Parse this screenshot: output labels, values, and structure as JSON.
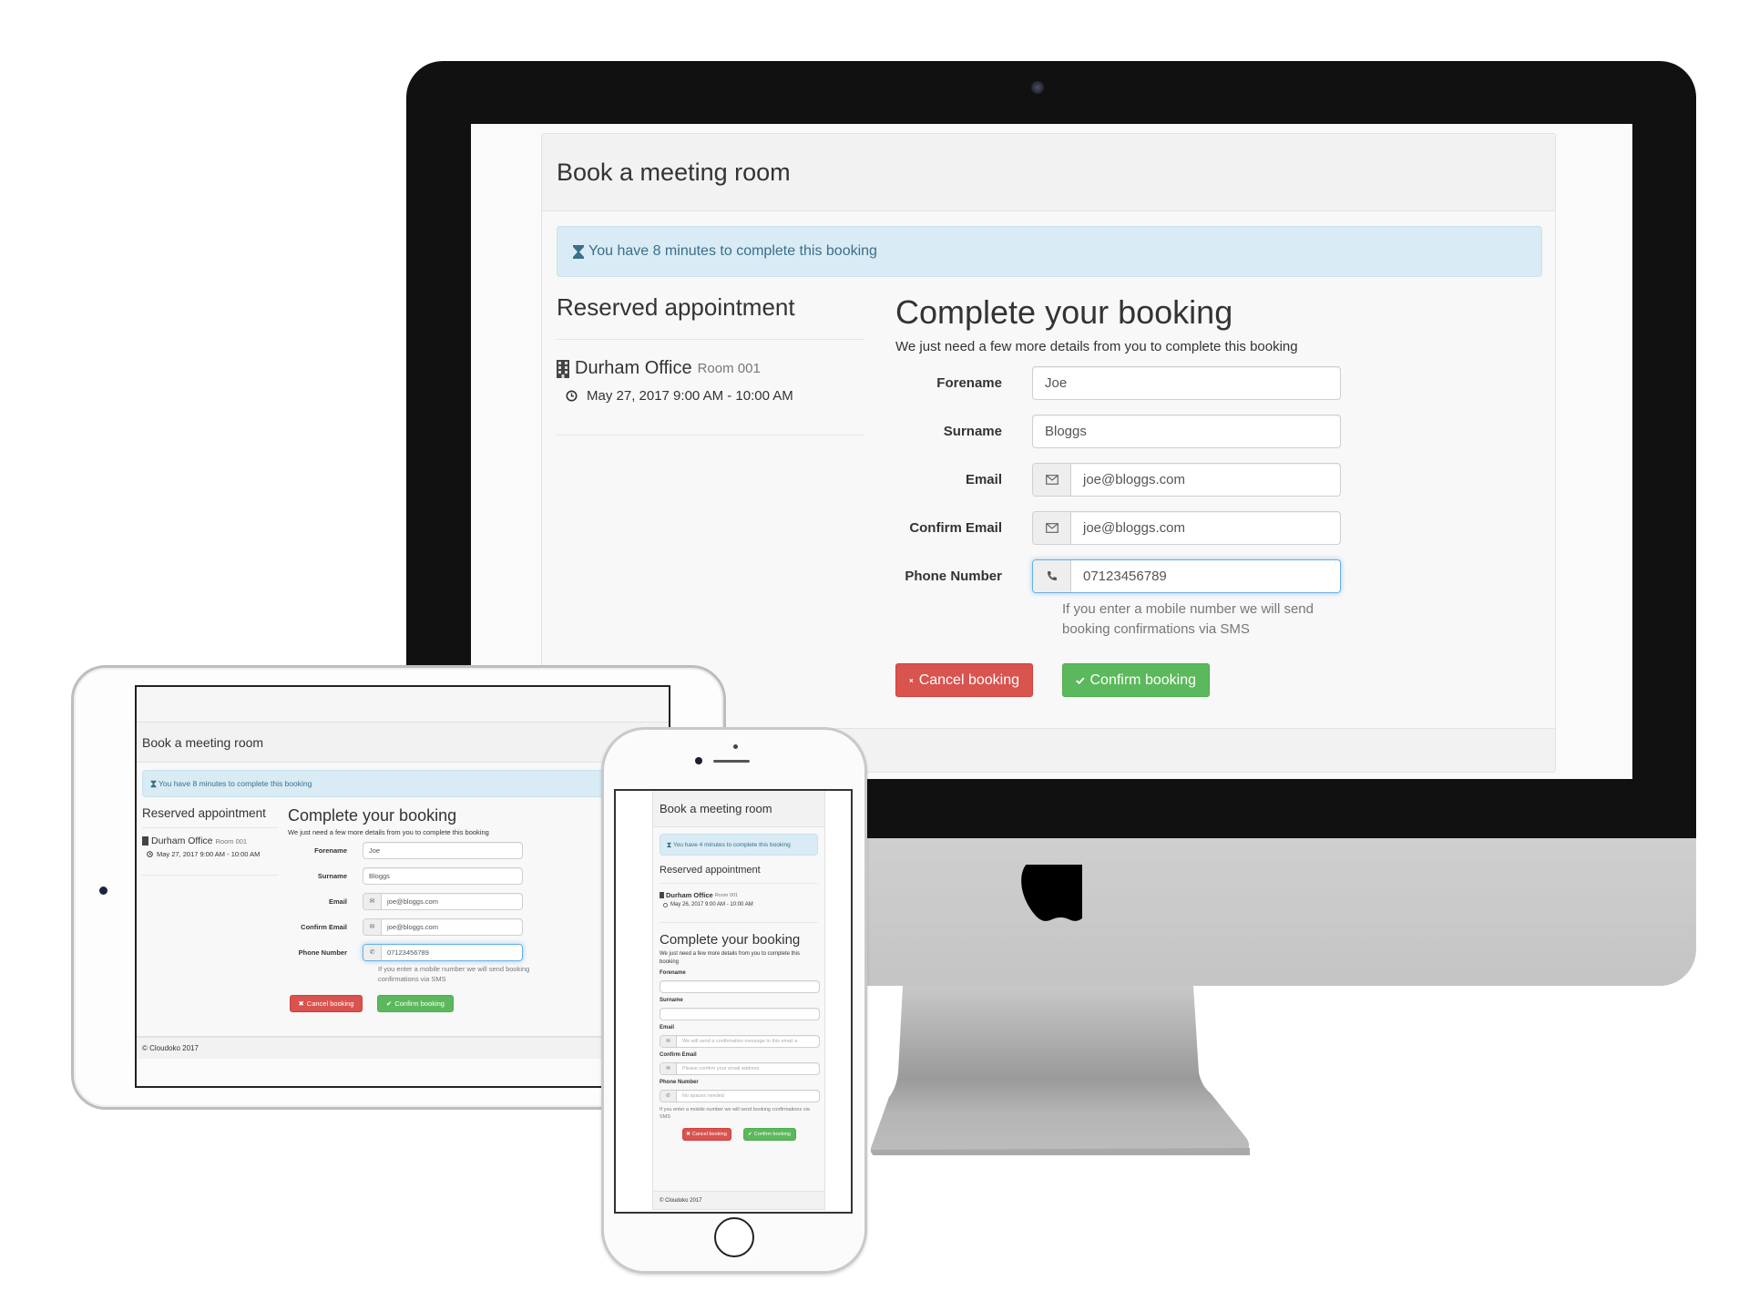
{
  "colors": {
    "danger": "#d9534f",
    "success": "#5cb85c",
    "info_bg": "#d9ebf4",
    "info_text": "#3a6f8c",
    "focus": "#66afe9"
  },
  "desktop": {
    "panel_title": "Book a meeting room",
    "alert": {
      "icon": "hourglass-icon",
      "text": "You have 8 minutes to complete this booking"
    },
    "reserved": {
      "heading": "Reserved appointment",
      "office_icon": "building-icon",
      "office": "Durham Office",
      "room": "Room 001",
      "time_icon": "clock-icon",
      "datetime": "May 27, 2017 9:00 AM - 10:00 AM"
    },
    "form": {
      "heading": "Complete your booking",
      "lead": "We just need a few more details from you to complete this booking",
      "fields": [
        {
          "label": "Forename",
          "value": "Joe",
          "icon": ""
        },
        {
          "label": "Surname",
          "value": "Bloggs",
          "icon": ""
        },
        {
          "label": "Email",
          "value": "joe@bloggs.com",
          "icon": "envelope-icon"
        },
        {
          "label": "Confirm Email",
          "value": "joe@bloggs.com",
          "icon": "envelope-icon"
        },
        {
          "label": "Phone Number",
          "value": "07123456789",
          "icon": "phone-icon"
        }
      ],
      "help": "If you enter a mobile number we will send booking confirmations via SMS",
      "cancel_label": "Cancel booking",
      "confirm_label": "Confirm booking"
    }
  },
  "tablet": {
    "panel_title": "Book a meeting room",
    "alert": {
      "text": "You have 8 minutes to complete this booking"
    },
    "reserved": {
      "heading": "Reserved appointment",
      "office": "Durham Office",
      "room": "Room 001",
      "datetime": "May 27, 2017 9:00 AM - 10:00 AM"
    },
    "form": {
      "heading": "Complete your booking",
      "lead": "We just need a few more details from you to complete this booking",
      "fields": [
        {
          "label": "Forename",
          "value": "Joe"
        },
        {
          "label": "Surname",
          "value": "Bloggs"
        },
        {
          "label": "Email",
          "value": "joe@bloggs.com"
        },
        {
          "label": "Confirm Email",
          "value": "joe@bloggs.com"
        },
        {
          "label": "Phone Number",
          "value": "07123456789"
        }
      ],
      "help": "If you enter a mobile number we will send booking confirmations via SMS",
      "cancel_label": "Cancel booking",
      "confirm_label": "Confirm booking"
    },
    "footer": "© Cloudoko 2017"
  },
  "phone": {
    "panel_title": "Book a meeting room",
    "alert": {
      "text": "You have 4 minutes to complete this booking"
    },
    "reserved": {
      "heading": "Reserved appointment",
      "office": "Durham Office",
      "room": "Room 001",
      "datetime": "May 26, 2017 9:00 AM - 10:00 AM"
    },
    "form": {
      "heading": "Complete your booking",
      "lead": "We just need a few more details from you to complete this booking",
      "fields": [
        {
          "label": "Forename",
          "value": "",
          "placeholder": ""
        },
        {
          "label": "Surname",
          "value": "",
          "placeholder": ""
        },
        {
          "label": "Email",
          "value": "",
          "placeholder": "We will send a confirmation message to this email a"
        },
        {
          "label": "Confirm Email",
          "value": "",
          "placeholder": "Please confirm your email address"
        },
        {
          "label": "Phone Number",
          "value": "",
          "placeholder": "No spaces needed"
        }
      ],
      "help": "If you enter a mobile number we will send booking confirmations via SMS",
      "cancel_label": "Cancel booking",
      "confirm_label": "Confirm booking"
    },
    "footer": "© Cloudoko 2017"
  }
}
